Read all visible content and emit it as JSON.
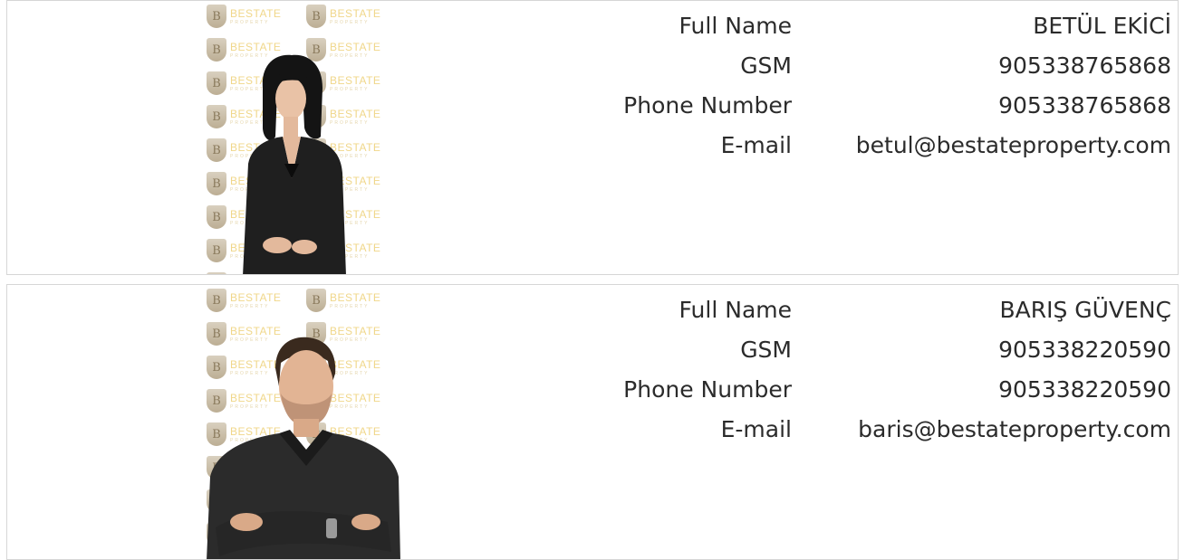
{
  "watermark": {
    "brand": "BESTATE",
    "sub": "PROPERTY",
    "shield_letter": "B"
  },
  "agents": [
    {
      "fields": [
        {
          "label": "Full Name",
          "value": "BETÜL EKİCİ"
        },
        {
          "label": "GSM",
          "value": "905338765868"
        },
        {
          "label": "Phone Number",
          "value": "905338765868"
        },
        {
          "label": "E-mail",
          "value": "betul@bestateproperty.com"
        }
      ]
    },
    {
      "fields": [
        {
          "label": "Full Name",
          "value": "BARIŞ GÜVENÇ"
        },
        {
          "label": "GSM",
          "value": "905338220590"
        },
        {
          "label": "Phone Number",
          "value": "905338220590"
        },
        {
          "label": "E-mail",
          "value": "baris@bestateproperty.com"
        }
      ]
    }
  ]
}
